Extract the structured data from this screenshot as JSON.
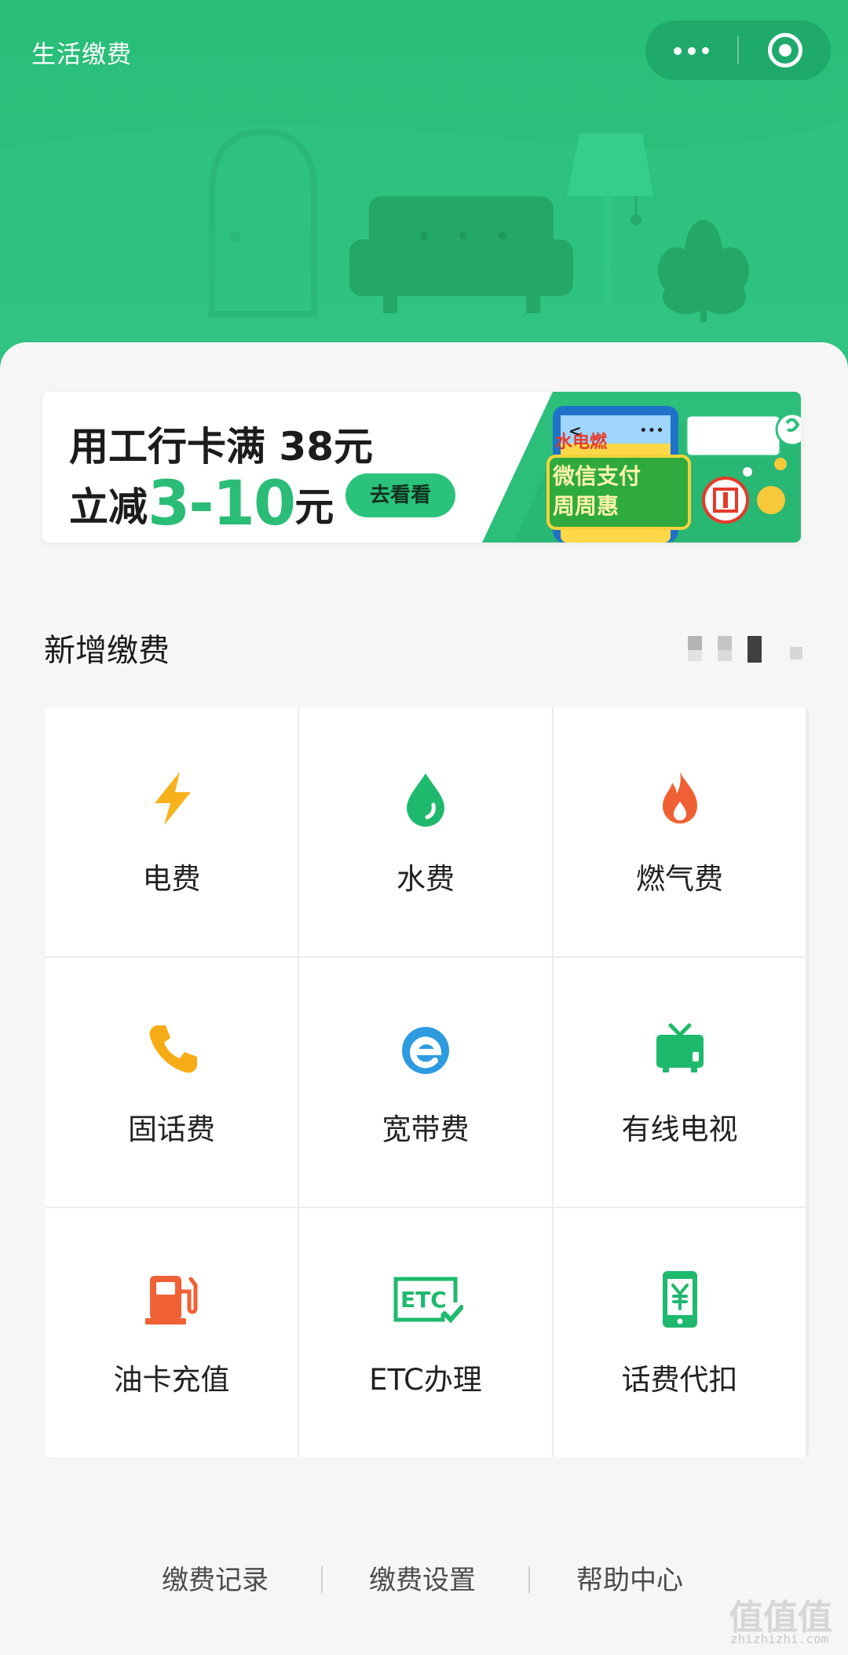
{
  "header": {
    "title": "生活缴费",
    "capsule": {
      "more_icon": "more-dots-icon",
      "close_icon": "target-close-icon"
    }
  },
  "banner": {
    "line1": "用工行卡满 38元",
    "line2_prefix": "立减",
    "line2_amount": "3-10",
    "line2_suffix": "元",
    "cta": "去看看",
    "art_label_1": "水电燃",
    "art_label_2": "微信支付",
    "art_label_3": "周周惠"
  },
  "section": {
    "title": "新增缴费"
  },
  "services": [
    {
      "label": "电费",
      "icon": "lightning-icon",
      "color": "#f7b21b"
    },
    {
      "label": "水费",
      "icon": "water-drop-icon",
      "color": "#1fb96e"
    },
    {
      "label": "燃气费",
      "icon": "flame-icon",
      "color": "#f06035"
    },
    {
      "label": "固话费",
      "icon": "phone-icon",
      "color": "#f7ab17"
    },
    {
      "label": "宽带费",
      "icon": "broadband-e-icon",
      "color": "#2e9ae0"
    },
    {
      "label": "有线电视",
      "icon": "tv-icon",
      "color": "#1fb96e"
    },
    {
      "label": "油卡充值",
      "icon": "fuel-pump-icon",
      "color": "#f06035"
    },
    {
      "label": "ETC办理",
      "icon": "etc-icon",
      "color": "#1fb96e"
    },
    {
      "label": "话费代扣",
      "icon": "mobile-yuan-icon",
      "color": "#1fb96e"
    }
  ],
  "footer": {
    "links": [
      "缴费记录",
      "缴费设置",
      "帮助中心"
    ]
  },
  "watermark": {
    "glyphs": "值值值",
    "domain": "zhizhizhi.com"
  },
  "colors": {
    "brand_green": "#2bbf7b",
    "background": "#f6f6f6"
  }
}
